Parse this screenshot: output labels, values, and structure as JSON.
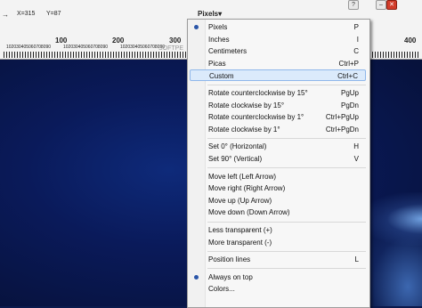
{
  "ruler": {
    "x_readout": "X=315",
    "y_readout": "Y=87",
    "unit_selector": "Pixels▾",
    "big_labels": [
      "100",
      "200",
      "300",
      "400"
    ],
    "small_labels": "102030405060708090",
    "watermark": "SOFTPE"
  },
  "window_buttons": [
    "?",
    "–",
    "✕"
  ],
  "menu": {
    "groups": [
      [
        {
          "label": "Pixels",
          "shortcut": "P",
          "checked": true
        },
        {
          "label": "Inches",
          "shortcut": "I"
        },
        {
          "label": "Centimeters",
          "shortcut": "C"
        },
        {
          "label": "Picas",
          "shortcut": "Ctrl+P"
        },
        {
          "label": "Custom",
          "shortcut": "Ctrl+C",
          "highlighted": true
        }
      ],
      [
        {
          "label": "Rotate counterclockwise by 15°",
          "shortcut": "PgUp"
        },
        {
          "label": "Rotate clockwise by 15°",
          "shortcut": "PgDn"
        },
        {
          "label": "Rotate counterclockwise by 1°",
          "shortcut": "Ctrl+PgUp"
        },
        {
          "label": "Rotate clockwise by 1°",
          "shortcut": "Ctrl+PgDn"
        }
      ],
      [
        {
          "label": "Set 0° (Horizontal)",
          "shortcut": "H"
        },
        {
          "label": "Set 90° (Vertical)",
          "shortcut": "V"
        }
      ],
      [
        {
          "label": "Move left (Left Arrow)",
          "shortcut": ""
        },
        {
          "label": "Move right (Right Arrow)",
          "shortcut": ""
        },
        {
          "label": "Move up (Up Arrow)",
          "shortcut": ""
        },
        {
          "label": "Move down (Down Arrow)",
          "shortcut": ""
        }
      ],
      [
        {
          "label": "Less transparent (+)",
          "shortcut": ""
        },
        {
          "label": "More transparent (-)",
          "shortcut": ""
        }
      ],
      [
        {
          "label": "Position lines",
          "shortcut": "L"
        }
      ],
      [
        {
          "label": "Always on top",
          "shortcut": "",
          "checked": true
        },
        {
          "label": "Colors...",
          "shortcut": ""
        }
      ]
    ]
  }
}
